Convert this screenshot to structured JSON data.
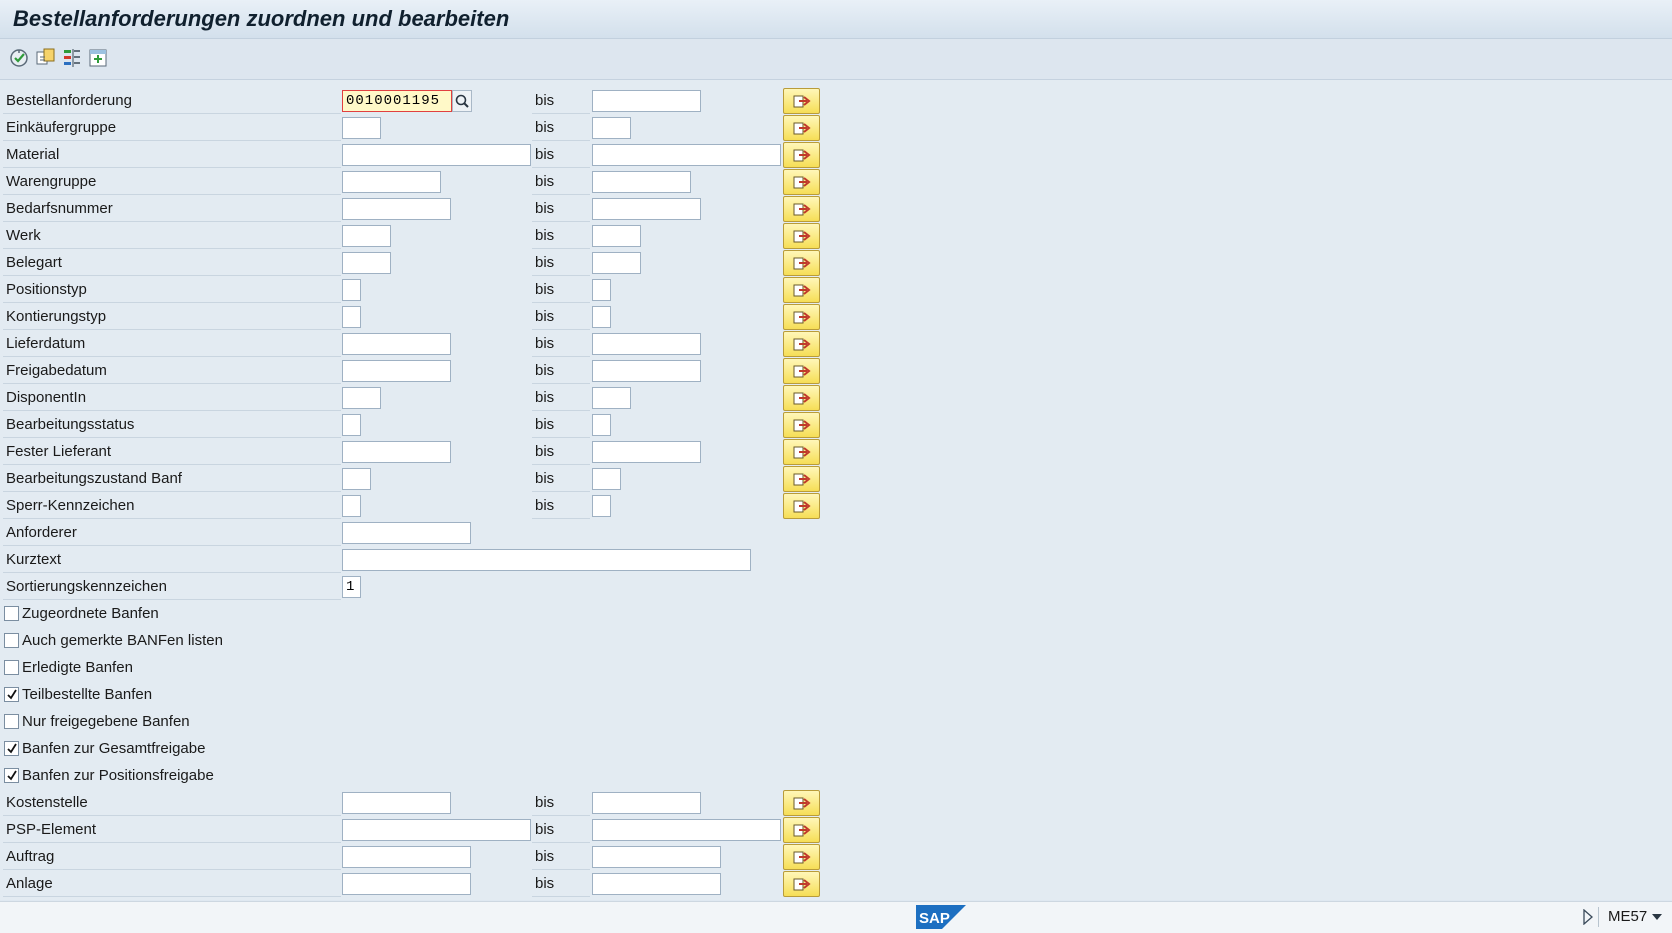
{
  "title": "Bestellanforderungen zuordnen und bearbeiten",
  "toolbar": {
    "icons": [
      "execute-icon",
      "get-variant-icon",
      "selection-options-icon",
      "multiple-selection-icon"
    ]
  },
  "bis_label": "bis",
  "fields": {
    "bestellanforderung": {
      "label": "Bestellanforderung",
      "value": "0010001195"
    },
    "einkaeufergruppe": {
      "label": "Einkäufergruppe"
    },
    "material": {
      "label": "Material"
    },
    "warengruppe": {
      "label": "Warengruppe"
    },
    "bedarfsnummer": {
      "label": "Bedarfsnummer"
    },
    "werk": {
      "label": "Werk"
    },
    "belegart": {
      "label": "Belegart"
    },
    "positionstyp": {
      "label": "Positionstyp"
    },
    "kontierungstyp": {
      "label": "Kontierungstyp"
    },
    "lieferdatum": {
      "label": "Lieferdatum"
    },
    "freigabedatum": {
      "label": "Freigabedatum"
    },
    "disponentin": {
      "label": "DisponentIn"
    },
    "bearbeitungsstatus": {
      "label": "Bearbeitungsstatus"
    },
    "fester_lieferant": {
      "label": "Fester Lieferant"
    },
    "bearbeitungszustand": {
      "label": "Bearbeitungszustand Banf"
    },
    "sperrkennzeichen": {
      "label": "Sperr-Kennzeichen"
    },
    "anforderer": {
      "label": "Anforderer"
    },
    "kurztext": {
      "label": "Kurztext"
    },
    "sortierungskennzeichen": {
      "label": "Sortierungskennzeichen",
      "value": "1"
    },
    "kostenstelle": {
      "label": "Kostenstelle"
    },
    "psp_element": {
      "label": "PSP-Element"
    },
    "auftrag": {
      "label": "Auftrag"
    },
    "anlage": {
      "label": "Anlage"
    }
  },
  "checkboxes": {
    "zugeordnete": {
      "label": "Zugeordnete Banfen",
      "checked": false
    },
    "gemerkte": {
      "label": "Auch gemerkte BANFen listen",
      "checked": false
    },
    "erledigte": {
      "label": "Erledigte Banfen",
      "checked": false
    },
    "teilbestellte": {
      "label": "Teilbestellte Banfen",
      "checked": true
    },
    "freigegebene": {
      "label": "Nur freigegebene Banfen",
      "checked": false
    },
    "gesamtfreigabe": {
      "label": "Banfen zur Gesamtfreigabe",
      "checked": true
    },
    "positionsfreigabe": {
      "label": "Banfen zur Positionsfreigabe",
      "checked": true
    }
  },
  "status": {
    "tcode": "ME57",
    "logo": "SAP",
    "colors": {
      "logo": "#1d6fc1",
      "multi_button": "#f6de57",
      "focus_field": "#fff9c8"
    }
  }
}
